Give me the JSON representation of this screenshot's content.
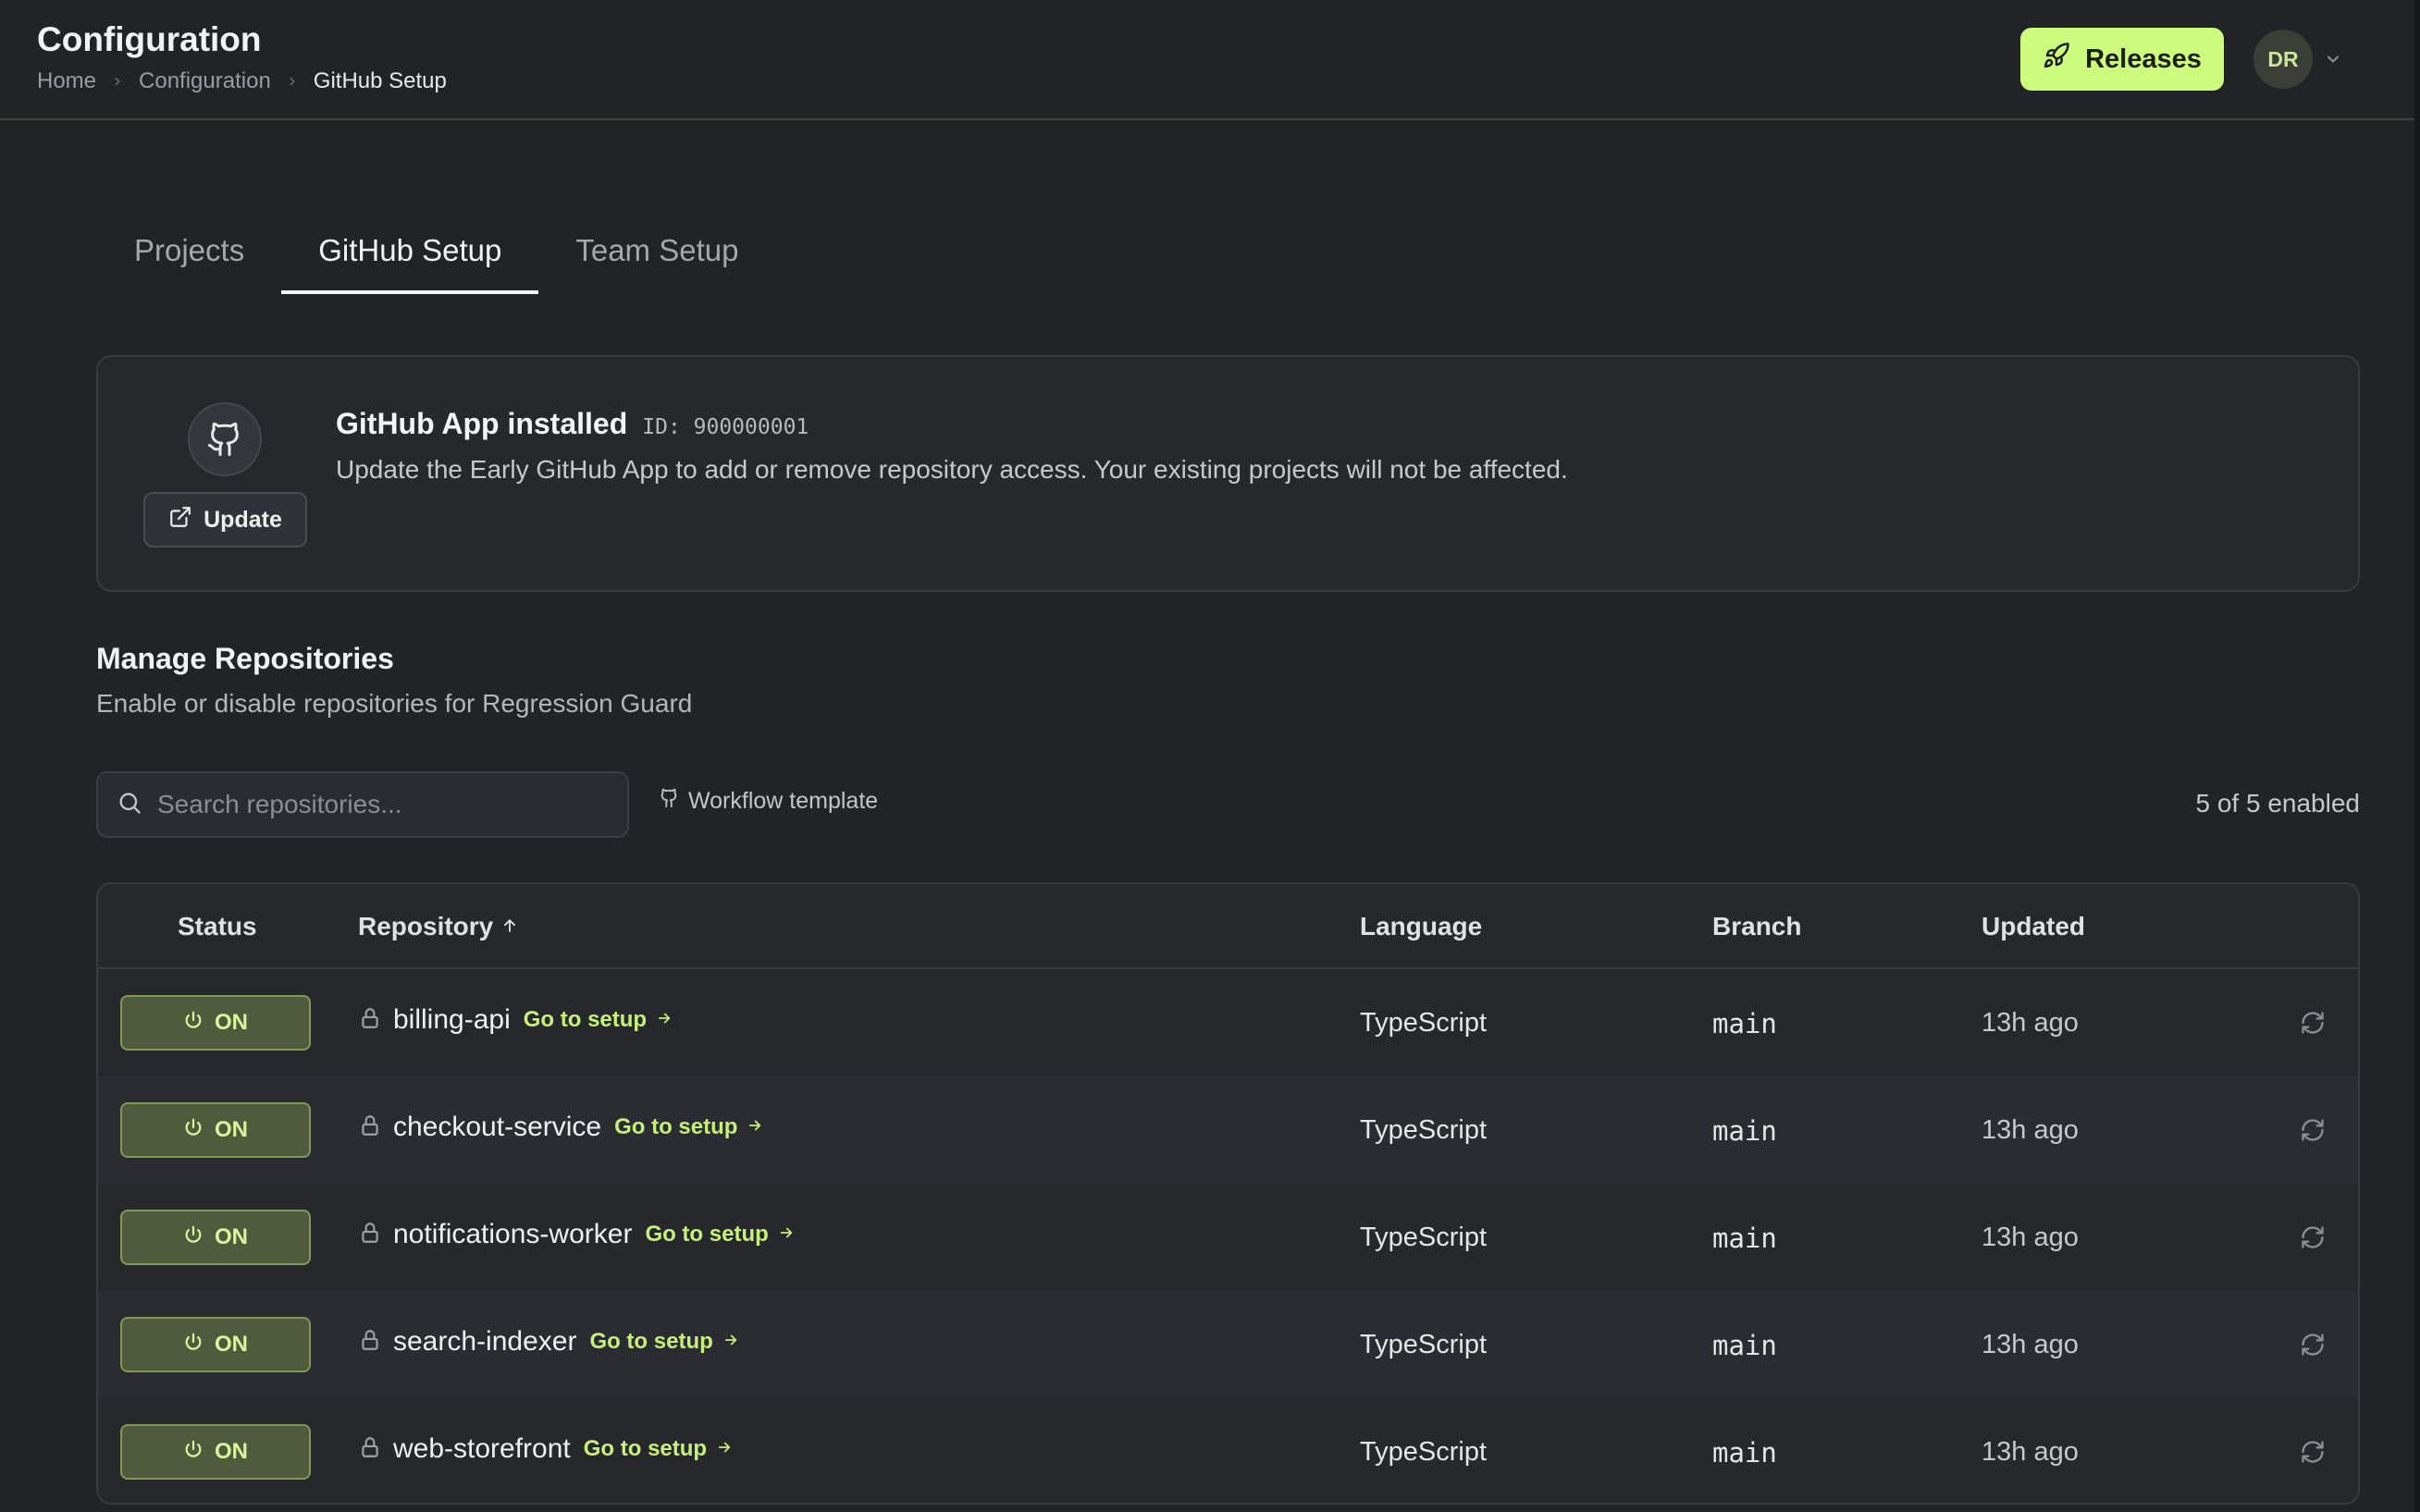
{
  "header": {
    "title": "Configuration",
    "breadcrumb": [
      "Home",
      "Configuration",
      "GitHub Setup"
    ],
    "releases_label": "Releases",
    "avatar_initials": "DR"
  },
  "tabs": [
    {
      "label": "Projects",
      "active": false
    },
    {
      "label": "GitHub Setup",
      "active": true
    },
    {
      "label": "Team Setup",
      "active": false
    }
  ],
  "app_card": {
    "title": "GitHub App installed",
    "id_text": "ID: 900000001",
    "description": "Update the Early GitHub App to add or remove repository access. Your existing projects will not be affected.",
    "update_label": "Update"
  },
  "manage": {
    "title": "Manage Repositories",
    "subtitle": "Enable or disable repositories for Regression Guard",
    "search_placeholder": "Search repositories...",
    "search_value": "",
    "workflow_label": "Workflow template",
    "enabled_count": "5 of 5 enabled"
  },
  "table": {
    "headers": {
      "status": "Status",
      "repository": "Repository",
      "language": "Language",
      "branch": "Branch",
      "updated": "Updated"
    },
    "sort": {
      "column": "repository",
      "direction": "asc",
      "icon": "arrow-up-icon"
    },
    "rows": [
      {
        "status": "ON",
        "name": "billing-api",
        "setup_link": "Go to setup",
        "language": "TypeScript",
        "branch": "main",
        "updated": "13h ago"
      },
      {
        "status": "ON",
        "name": "checkout-service",
        "setup_link": "Go to setup",
        "language": "TypeScript",
        "branch": "main",
        "updated": "13h ago"
      },
      {
        "status": "ON",
        "name": "notifications-worker",
        "setup_link": "Go to setup",
        "language": "TypeScript",
        "branch": "main",
        "updated": "13h ago"
      },
      {
        "status": "ON",
        "name": "search-indexer",
        "setup_link": "Go to setup",
        "language": "TypeScript",
        "branch": "main",
        "updated": "13h ago"
      },
      {
        "status": "ON",
        "name": "web-storefront",
        "setup_link": "Go to setup",
        "language": "TypeScript",
        "branch": "main",
        "updated": "13h ago"
      }
    ]
  },
  "colors": {
    "background": "#222327",
    "accent": "#cdfb7e",
    "on_badge_bg": "#4f5b3c",
    "on_badge_text": "#d9f59d",
    "link": "#c6f07a"
  },
  "icons": {
    "releases": "rocket-icon",
    "avatar_menu": "chevron-down-icon",
    "github": "github-icon",
    "update": "external-link-icon",
    "search": "search-icon",
    "workflow": "git-branch-icon",
    "status": "power-icon",
    "private_repo": "lock-icon",
    "setup": "arrow-right-icon",
    "sync": "refresh-icon"
  }
}
